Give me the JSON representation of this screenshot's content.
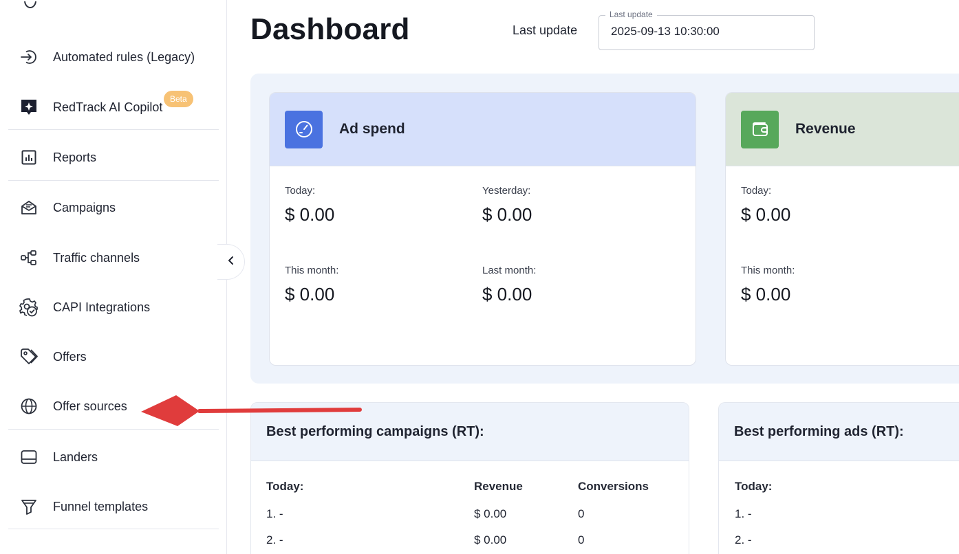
{
  "sidebar": {
    "items": [
      {
        "label": "Automated rules (Legacy)",
        "icon": "arrow-into-circle-icon"
      },
      {
        "label": "RedTrack AI Copilot",
        "icon": "ai-sparkle-icon",
        "badge": "Beta"
      },
      {
        "label": "Reports",
        "icon": "bar-chart-icon"
      },
      {
        "label": "Campaigns",
        "icon": "campaign-envelope-icon"
      },
      {
        "label": "Traffic channels",
        "icon": "traffic-channels-icon"
      },
      {
        "label": "CAPI Integrations",
        "icon": "gear-check-icon"
      },
      {
        "label": "Offers",
        "icon": "tag-icon"
      },
      {
        "label": "Offer sources",
        "icon": "globe-icon"
      },
      {
        "label": "Landers",
        "icon": "lander-window-icon"
      },
      {
        "label": "Funnel templates",
        "icon": "funnel-icon"
      }
    ],
    "colors": {
      "badge": "#f7c275",
      "text": "#1f2330"
    }
  },
  "header": {
    "title": "Dashboard",
    "last_update_label": "Last update",
    "last_update_legend": "Last update",
    "last_update_value": "2025-09-13 10:30:00"
  },
  "cards": {
    "ad_spend": {
      "title": "Ad spend",
      "icon": "speedometer-icon",
      "header_color": "#d6e0fb",
      "icon_color": "#4a72e0",
      "today_label": "Today:",
      "today_value": "$ 0.00",
      "yesterday_label": "Yesterday:",
      "yesterday_value": "$ 0.00",
      "this_month_label": "This month:",
      "this_month_value": "$ 0.00",
      "last_month_label": "Last month:",
      "last_month_value": "$ 0.00"
    },
    "revenue": {
      "title": "Revenue",
      "icon": "wallet-icon",
      "header_color": "#dbe5d9",
      "icon_color": "#57a85b",
      "today_label": "Today:",
      "today_value": "$ 0.00",
      "this_month_label": "This month:",
      "this_month_value": "$ 0.00"
    }
  },
  "best_campaigns": {
    "title": "Best performing campaigns (RT):",
    "period_label": "Today:",
    "columns": [
      "Revenue",
      "Conversions"
    ],
    "rows": [
      {
        "name": "1. -",
        "revenue": "$ 0.00",
        "conversions": "0"
      },
      {
        "name": "2. -",
        "revenue": "$ 0.00",
        "conversions": "0"
      }
    ]
  },
  "best_ads": {
    "title": "Best performing ads (RT):",
    "period_label": "Today:",
    "rows": [
      {
        "name": "1. -"
      },
      {
        "name": "2. -"
      }
    ]
  },
  "annotation": {
    "arrow_color": "#e03c3c"
  }
}
